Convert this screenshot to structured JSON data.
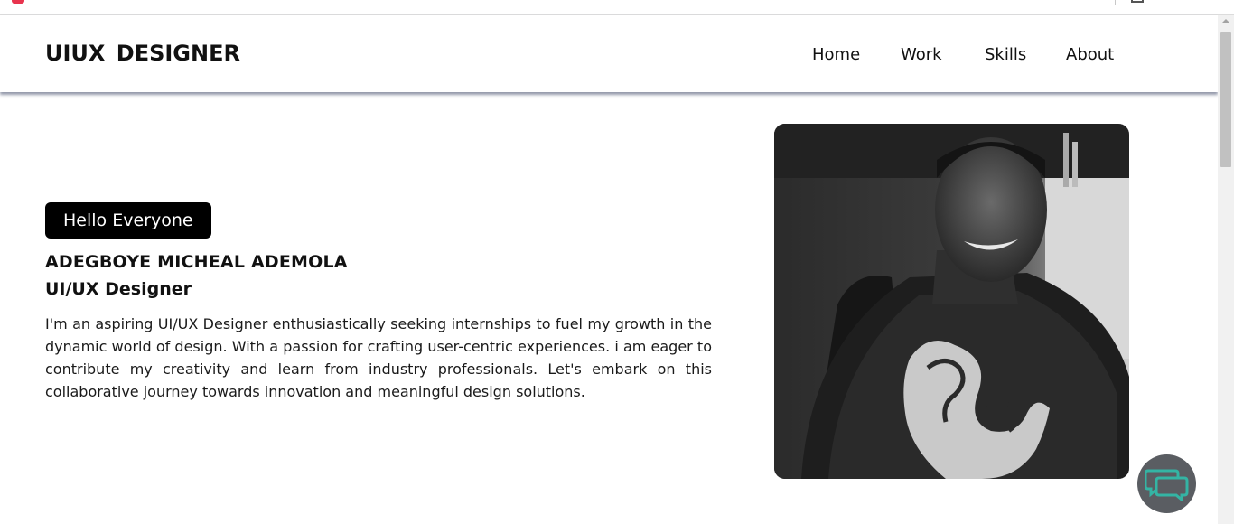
{
  "header": {
    "logo": "UIUX  DESIGNER",
    "nav": {
      "home": "Home",
      "work": "Work",
      "skills": "Skills",
      "about": "About"
    }
  },
  "hero": {
    "greeting": "Hello Everyone",
    "name": "ADEGBOYE MICHEAL ADEMOLA",
    "role": "UI/UX Designer",
    "bio": "I'm an aspiring UI/UX Designer enthusiastically seeking internships to fuel my growth in the dynamic world of design. With a passion for crafting user-centric experiences. i am eager to contribute my creativity and learn from industry professionals. Let's embark on this collaborative journey towards innovation and meaningful design solutions."
  },
  "colors": {
    "badge_bg": "#000000",
    "chat_bg": "#5a5d62",
    "chat_icon": "#34b4a4"
  },
  "icons": {
    "chat": "chat-bubbles-icon"
  }
}
